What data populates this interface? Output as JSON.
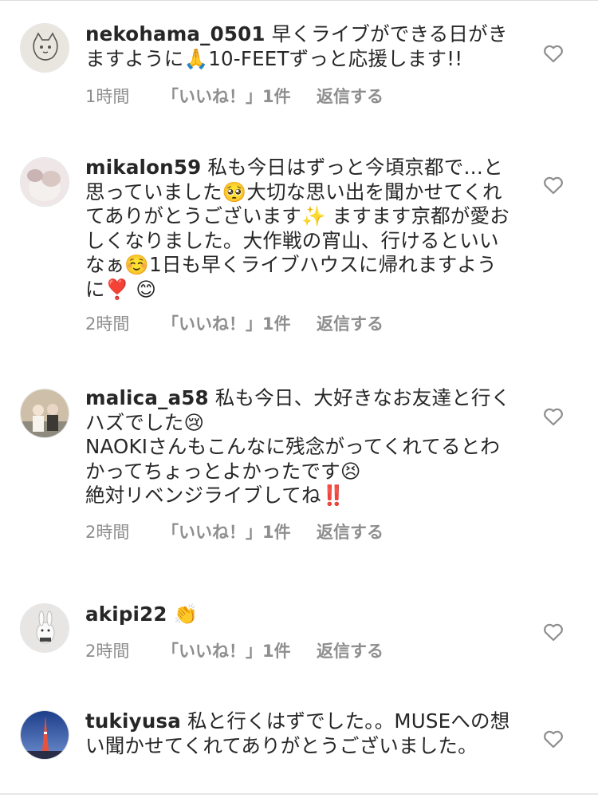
{
  "comments": [
    {
      "username": "nekohama_0501",
      "text": "早くライブができる日がきますように🙏10-FEETずっと応援します!!",
      "time": "1時間",
      "likes": "「いいね！」1件",
      "reply": "返信する"
    },
    {
      "username": "mikalon59",
      "text": "私も今日はずっと今頃京都で…と思っていました🥺大切な思い出を聞かせてくれてありがとうございます✨ ますます京都が愛おしくなりました。大作戦の宵山、行けるといいなぁ☺️1日も早くライブハウスに帰れますように❣️ 😊",
      "time": "2時間",
      "likes": "「いいね！」1件",
      "reply": "返信する"
    },
    {
      "username": "malica_a58",
      "text": "私も今日、大好きなお友達と行くハズでした😢\nNAOKIさんもこんなに残念がってくれてるとわかってちょっとよかったです😣\n絶対リベンジライブしてね‼️",
      "time": "2時間",
      "likes": "「いいね！」1件",
      "reply": "返信する"
    },
    {
      "username": "akipi22",
      "text": "👏",
      "time": "2時間",
      "likes": "「いいね！」1件",
      "reply": "返信する"
    },
    {
      "username": "tukiyusa",
      "text": "私と行くはずでした。。MUSEへの想い聞かせてくれてありがとうございました。",
      "time": "",
      "likes": "",
      "reply": ""
    }
  ]
}
